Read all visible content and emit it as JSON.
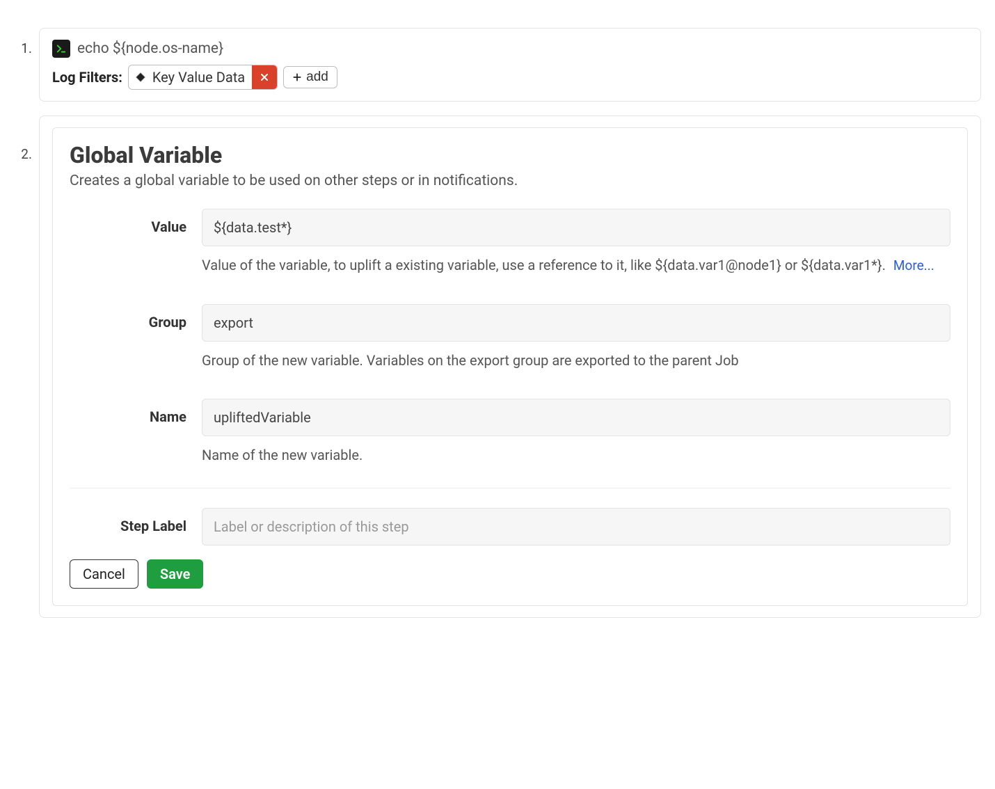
{
  "step1": {
    "number": "1.",
    "command": "echo ${node.os-name}",
    "filters_label": "Log Filters:",
    "filter_name": "Key Value Data",
    "add_label": "add"
  },
  "step2": {
    "number": "2.",
    "title": "Global Variable",
    "description": "Creates a global variable to be used on other steps or in notifications.",
    "fields": {
      "value": {
        "label": "Value",
        "value": "${data.test*}",
        "help_prefix": "Value of the variable, to uplift a existing variable, use a reference to it, like ${data.var1@node1} or ${data.var1*}.",
        "more": "More..."
      },
      "group": {
        "label": "Group",
        "value": "export",
        "help": "Group of the new variable. Variables on the export group are exported to the parent Job"
      },
      "name": {
        "label": "Name",
        "value": "upliftedVariable",
        "help": "Name of the new variable."
      },
      "step_label": {
        "label": "Step Label",
        "placeholder": "Label or description of this step"
      }
    },
    "buttons": {
      "cancel": "Cancel",
      "save": "Save"
    }
  }
}
